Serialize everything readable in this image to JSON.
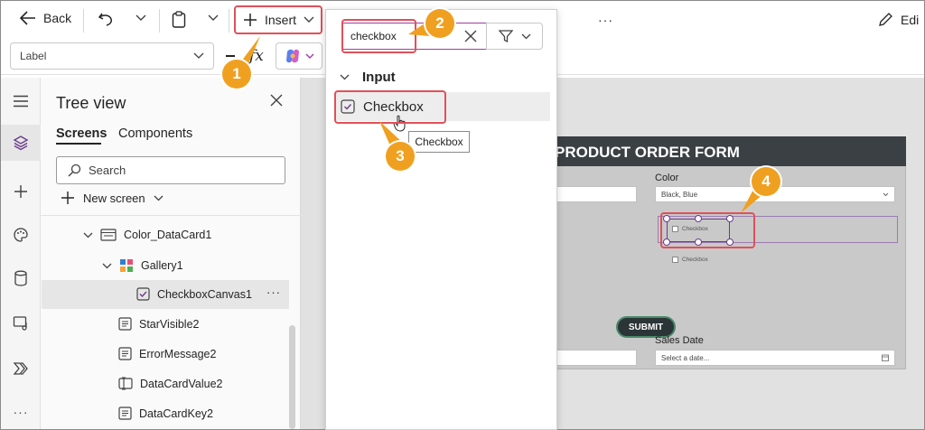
{
  "toolbar": {
    "back_label": "Back",
    "insert_label": "Insert",
    "more_label": "···",
    "edit_label": "Edi"
  },
  "formula_bar": {
    "property_value": "Label",
    "fx_label": "fx"
  },
  "tree_view": {
    "title": "Tree view",
    "tabs": [
      {
        "label": "Screens",
        "active": true
      },
      {
        "label": "Components",
        "active": false
      }
    ],
    "search_placeholder": "Search",
    "new_screen_label": "New screen",
    "nodes": [
      {
        "label": "Color_DataCard1",
        "icon": "card-icon"
      },
      {
        "label": "Gallery1",
        "icon": "gallery-icon"
      },
      {
        "label": "CheckboxCanvas1",
        "icon": "checkbox-icon",
        "selected": true,
        "more": "···"
      },
      {
        "label": "StarVisible2",
        "icon": "label-icon"
      },
      {
        "label": "ErrorMessage2",
        "icon": "label-icon"
      },
      {
        "label": "DataCardValue2",
        "icon": "text-input-icon"
      },
      {
        "label": "DataCardKey2",
        "icon": "label-icon"
      }
    ]
  },
  "insert_panel": {
    "search_value": "checkbox",
    "section_label": "Input",
    "item_label": "Checkbox",
    "tooltip": "Checkbox"
  },
  "form": {
    "title": "PRODUCT ORDER FORM",
    "color_label": "Color",
    "color_value": "Black, Blue",
    "checkbox_label_1": "Checkbox",
    "checkbox_label_2": "Checkbox",
    "submit_label": "SUBMIT",
    "sales_date_label": "Sales Date",
    "sales_date_placeholder": "Select a date..."
  },
  "callouts": {
    "step1": "1",
    "step2": "2",
    "step3": "3",
    "step4": "4"
  },
  "colors": {
    "accent_purple": "#9b3fa0",
    "callout_orange": "#f0a020",
    "callout_red": "#e0505a",
    "form_header": "#3a4044"
  }
}
